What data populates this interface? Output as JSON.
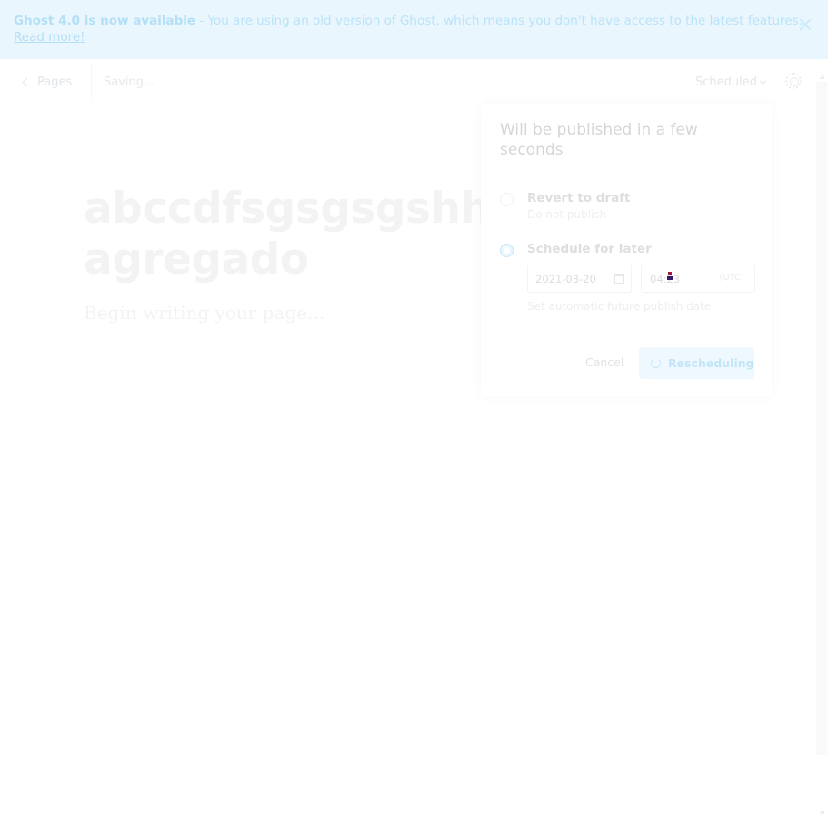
{
  "banner": {
    "headline": "Ghost 4.0 is now available",
    "message": " - You are using an old version of Ghost, which means you don't have access to the latest features.",
    "link": "Read more!"
  },
  "topbar": {
    "back_label": "Pages",
    "saving": "Saving...",
    "status": "Scheduled"
  },
  "editor": {
    "title_line1": "abcсdfsgsgsgshhh...",
    "title_line2": "agregado",
    "body_placeholder": "Begin writing your page..."
  },
  "popover": {
    "title": "Will be published in a few seconds",
    "option_draft": {
      "label": "Revert to draft",
      "sub": "Do not publish"
    },
    "option_schedule": {
      "label": "Schedule for later"
    },
    "date": "2021-03-20",
    "time": "04:23",
    "timezone": "(UTC)",
    "help": "Set automatic future publish date",
    "cancel": "Cancel",
    "confirm": "Rescheduling"
  }
}
